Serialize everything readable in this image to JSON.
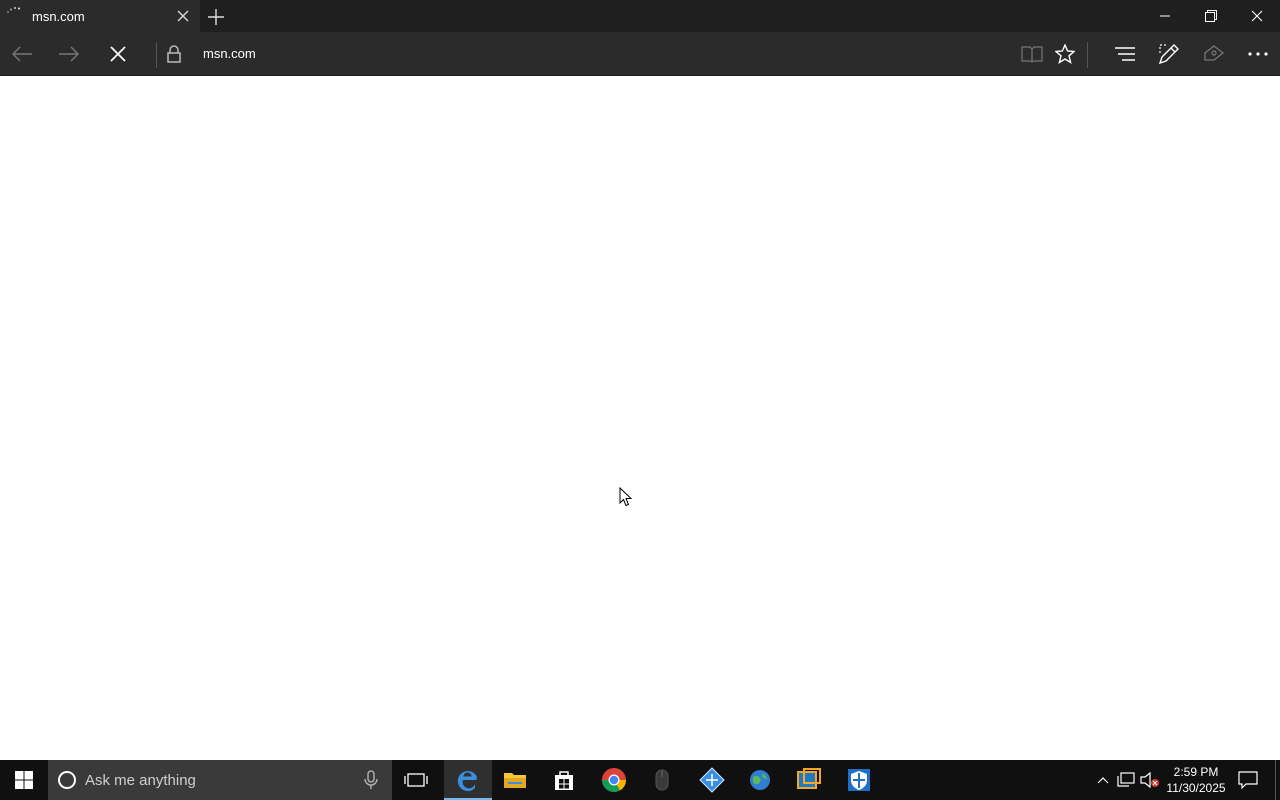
{
  "browser": {
    "tab": {
      "title": "msn.com"
    },
    "address_bar": {
      "url": "msn.com"
    }
  },
  "icons": {
    "tab_loading": "loading-spinner-icon",
    "tab_close": "close-icon",
    "new_tab": "plus-icon",
    "minimize": "minimize-icon",
    "restore": "restore-icon",
    "close_window": "close-icon",
    "back": "arrow-left-icon",
    "forward": "arrow-right-icon",
    "stop": "x-icon",
    "lock": "lock-icon",
    "reading_view": "book-icon",
    "favorite": "star-icon",
    "hub": "hub-lines-icon",
    "web_note": "pen-icon",
    "share": "share-icon",
    "more": "more-dots-icon"
  },
  "taskbar": {
    "search_placeholder": "Ask me anything",
    "apps": [
      "Edge",
      "File Explorer",
      "Store",
      "Chrome",
      "Mouse",
      "Tool",
      "Globe",
      "Window",
      "Defender"
    ],
    "clock": {
      "time": "2:59 PM",
      "date": "11/30/2025"
    }
  },
  "colors": {
    "titlebar": "#1f1f1f",
    "toolbar": "#2b2b2b",
    "taskbar": "#101010",
    "accent": "#76b9ed"
  }
}
